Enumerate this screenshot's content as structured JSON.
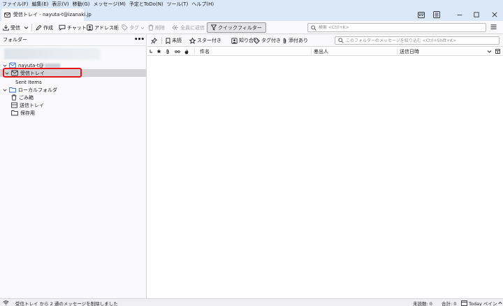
{
  "menu": {
    "items": [
      "ファイル(F)",
      "編集(E)",
      "表示(V)",
      "移動(G)",
      "メッセージ(M)",
      "予定とToDo(N)",
      "ツール(T)",
      "ヘルプ(H)"
    ]
  },
  "tab": {
    "title": "受信トレイ - nayuta-t@izanaki.jp"
  },
  "toolbar": {
    "get_mail": "受信",
    "write": "作成",
    "chat": "チャット",
    "address_book": "アドレス帳",
    "tag": "タグ",
    "delete": "削除",
    "reply_all": "全員に返信",
    "quick_filter": "クイックフィルター",
    "search_placeholder": "検索 <Ctrl+K>"
  },
  "folder_pane": {
    "header": "フォルダー",
    "account_name": "nayuta-t@",
    "folders": {
      "inbox": "受信トレイ",
      "sent": "Sent Items",
      "local": "ローカルフォルダ",
      "trash": "ごみ箱",
      "outbox": "送信トレイ",
      "archive": "保存用"
    }
  },
  "quick_filter": {
    "unread": "未読",
    "starred": "スター付き",
    "contacts": "知り合い",
    "tagged": "タグ付き",
    "attachment": "添付あり",
    "search_placeholder": "このフォルダーのメッセージを絞り込む <Ctrl+Shift+K>"
  },
  "columns": {
    "subject": "件名",
    "sender": "差出人",
    "date": "送信日時"
  },
  "status": {
    "message": "受信トレイ から 2 通のメッセージを削除しました",
    "unread": "未読数: 0",
    "total": "合計: 0",
    "today_pane": "Today ペイン"
  },
  "colors": {
    "accent": "#0060df",
    "highlight": "#e3141b",
    "chrome": "#dbe8f8"
  }
}
